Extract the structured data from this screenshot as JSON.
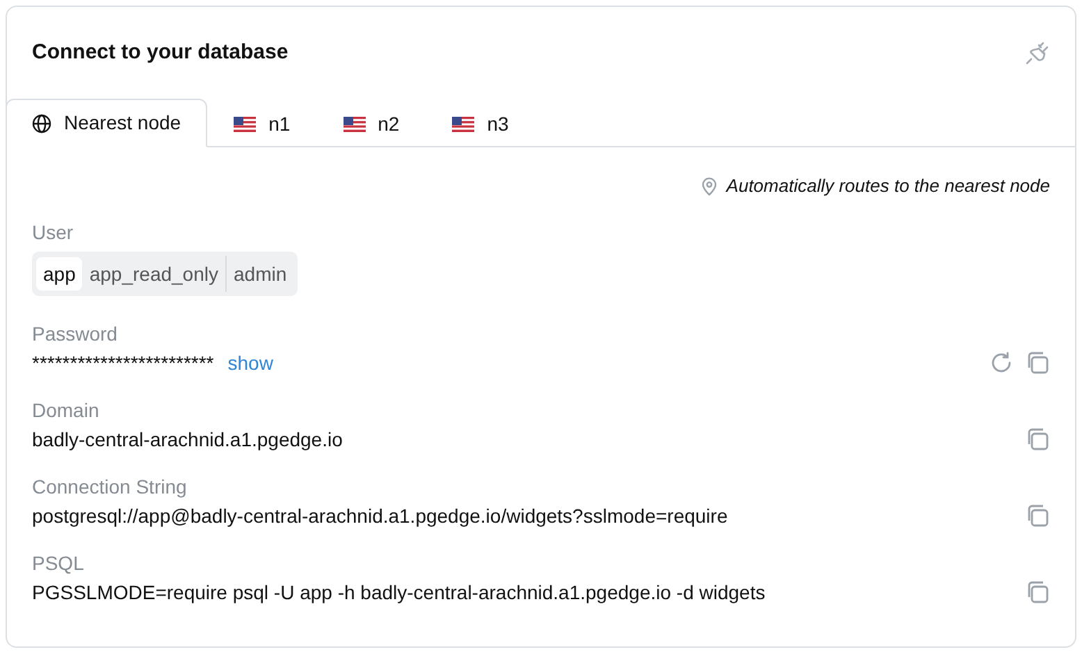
{
  "title": "Connect to your database",
  "tabs": [
    {
      "label": "Nearest node",
      "kind": "globe",
      "selected": true
    },
    {
      "label": "n1",
      "kind": "flag",
      "selected": false
    },
    {
      "label": "n2",
      "kind": "flag",
      "selected": false
    },
    {
      "label": "n3",
      "kind": "flag",
      "selected": false
    }
  ],
  "routing_note": "Automatically routes to the nearest node",
  "user": {
    "label": "User",
    "options": [
      {
        "label": "app",
        "selected": true
      },
      {
        "label": "app_read_only",
        "selected": false
      },
      {
        "label": "admin",
        "selected": false
      }
    ]
  },
  "fields": [
    {
      "kind": "password",
      "label": "Password",
      "value": "************************",
      "link": "show"
    },
    {
      "kind": "text",
      "label": "Domain",
      "value": "badly-central-arachnid.a1.pgedge.io"
    },
    {
      "kind": "text",
      "label": "Connection String",
      "value": "postgresql://app@badly-central-arachnid.a1.pgedge.io/widgets?sslmode=require"
    },
    {
      "kind": "text",
      "label": "PSQL",
      "value": "PGSSLMODE=require psql -U app -h badly-central-arachnid.a1.pgedge.io -d widgets"
    }
  ]
}
